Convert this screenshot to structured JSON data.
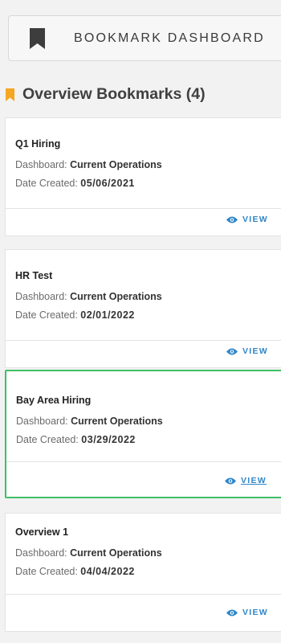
{
  "dashboard_button": {
    "label": "BOOKMARK DASHBOARD",
    "icon": "bookmark-icon"
  },
  "section": {
    "title": "Overview Bookmarks (4)",
    "icon": "bookmark-flag-icon",
    "accent_color": "#f5a623"
  },
  "colors": {
    "link": "#2f86c8",
    "selected_border": "#3fbf66"
  },
  "bookmarks": [
    {
      "name": "Q1 Hiring",
      "dashboard_label": "Dashboard:",
      "dashboard_value": "Current Operations",
      "date_label": "Date Created:",
      "date_value": "05/06/2021",
      "view_label": "VIEW"
    },
    {
      "name": "HR Test",
      "dashboard_label": "Dashboard:",
      "dashboard_value": "Current Operations",
      "date_label": "Date Created:",
      "date_value": "02/01/2022",
      "view_label": "VIEW"
    },
    {
      "name": "Bay Area Hiring",
      "dashboard_label": "Dashboard:",
      "dashboard_value": "Current Operations",
      "date_label": "Date Created:",
      "date_value": "03/29/2022",
      "view_label": "VIEW",
      "selected": true
    },
    {
      "name": "Overview 1",
      "dashboard_label": "Dashboard:",
      "dashboard_value": "Current Operations",
      "date_label": "Date Created:",
      "date_value": "04/04/2022",
      "view_label": "VIEW"
    }
  ]
}
